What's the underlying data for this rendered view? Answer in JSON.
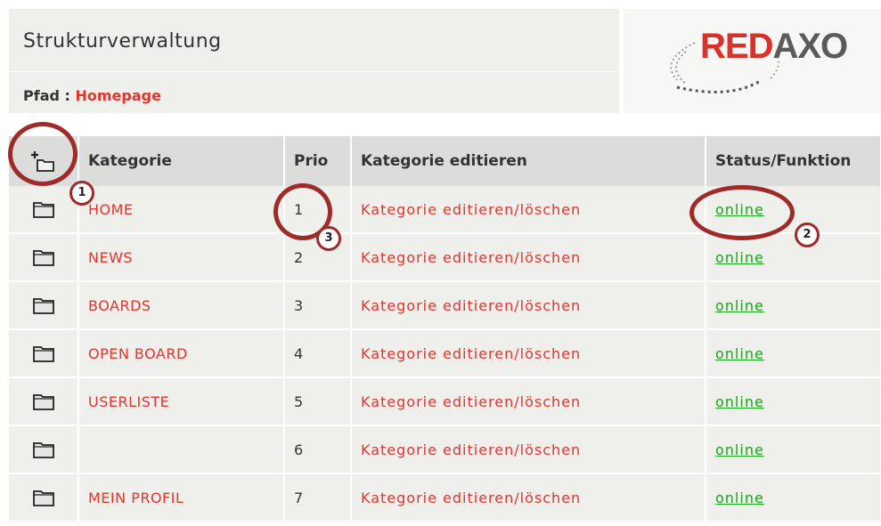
{
  "header": {
    "title": "Strukturverwaltung",
    "path_label": "Pfad : ",
    "path_current": "Homepage"
  },
  "logo": {
    "part1": "RED",
    "part2": "AXO"
  },
  "table": {
    "columns": [
      "",
      "Kategorie",
      "Prio",
      "Kategorie editieren",
      "Status/Funktion"
    ],
    "rows": [
      {
        "kategorie": "HOME",
        "prio": "1",
        "edit": "Kategorie editieren/löschen",
        "status": "online"
      },
      {
        "kategorie": "NEWS",
        "prio": "2",
        "edit": "Kategorie editieren/löschen",
        "status": "online"
      },
      {
        "kategorie": "BOARDS",
        "prio": "3",
        "edit": "Kategorie editieren/löschen",
        "status": "online"
      },
      {
        "kategorie": "OPEN BOARD",
        "prio": "4",
        "edit": "Kategorie editieren/löschen",
        "status": "online"
      },
      {
        "kategorie": "USERLISTE",
        "prio": "5",
        "edit": "Kategorie editieren/löschen",
        "status": "online"
      },
      {
        "kategorie": "",
        "prio": "6",
        "edit": "Kategorie editieren/löschen",
        "status": "online"
      },
      {
        "kategorie": "MEIN PROFIL",
        "prio": "7",
        "edit": "Kategorie editieren/löschen",
        "status": "online"
      }
    ]
  },
  "annotations": [
    "1",
    "2",
    "3"
  ],
  "colors": {
    "link_red": "#e3352f",
    "status_green": "#1aa61a",
    "marker": "#9e2a2a"
  }
}
